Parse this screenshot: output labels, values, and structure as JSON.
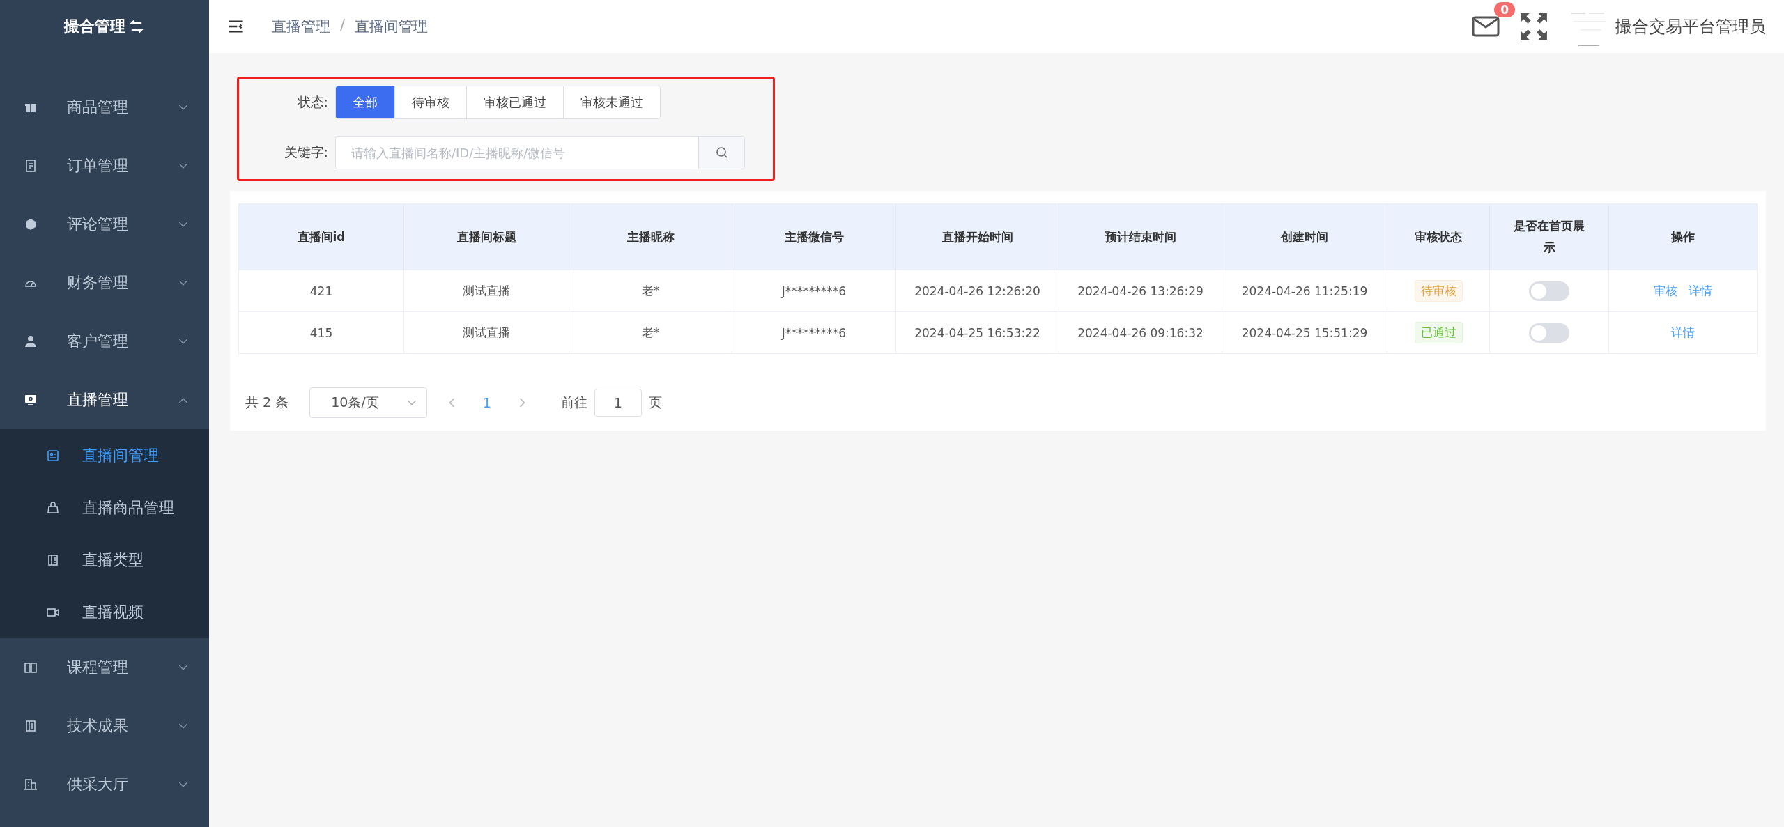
{
  "sidebar": {
    "title": "撮合管理",
    "items": [
      {
        "label": "商品管理",
        "expanded": false
      },
      {
        "label": "订单管理",
        "expanded": false
      },
      {
        "label": "评论管理",
        "expanded": false
      },
      {
        "label": "财务管理",
        "expanded": false
      },
      {
        "label": "客户管理",
        "expanded": false
      },
      {
        "label": "直播管理",
        "expanded": true,
        "children": [
          {
            "label": "直播间管理",
            "selected": true
          },
          {
            "label": "直播商品管理",
            "selected": false
          },
          {
            "label": "直播类型",
            "selected": false
          },
          {
            "label": "直播视频",
            "selected": false
          }
        ]
      },
      {
        "label": "课程管理",
        "expanded": false
      },
      {
        "label": "技术成果",
        "expanded": false
      },
      {
        "label": "供采大厅",
        "expanded": false
      }
    ]
  },
  "header": {
    "breadcrumbs": [
      "直播管理",
      "/",
      "直播间管理"
    ],
    "message_count": "0",
    "user_name": "撮合交易平台管理员"
  },
  "filter": {
    "status_label": "状态:",
    "status_tabs": [
      {
        "label": "全部",
        "selected": true
      },
      {
        "label": "待审核",
        "selected": false
      },
      {
        "label": "审核已通过",
        "selected": false
      },
      {
        "label": "审核未通过",
        "selected": false
      }
    ],
    "keyword_label": "关键字:",
    "keyword_placeholder": "请输入直播间名称/ID/主播昵称/微信号"
  },
  "table": {
    "columns": [
      "直播间id",
      "直播间标题",
      "主播昵称",
      "主播微信号",
      "直播开始时间",
      "预计结束时间",
      "创建时间",
      "审核状态",
      "是否在首页展示",
      "操作"
    ],
    "rows": [
      {
        "cells": [
          "421",
          "测试直播",
          "老*",
          "J*********6",
          "2024-04-26 12:26:20",
          "2024-04-26 13:26:29",
          "2024-04-26 11:25:19"
        ],
        "status": {
          "label": "待审核",
          "kind": "pending"
        },
        "on_home": false,
        "actions": [
          "审核",
          "详情"
        ]
      },
      {
        "cells": [
          "415",
          "测试直播",
          "老*",
          "J*********6",
          "2024-04-25 16:53:22",
          "2024-04-26 09:16:32",
          "2024-04-25 15:51:29"
        ],
        "status": {
          "label": "已通过",
          "kind": "approved"
        },
        "on_home": false,
        "actions": [
          "详情"
        ]
      }
    ]
  },
  "pagination": {
    "total": "共 2 条",
    "page_size": "10条/页",
    "pages": [
      {
        "label": "1",
        "selected": true
      }
    ],
    "goto_label": "前往",
    "goto_value": "1",
    "page_suffix": "页"
  }
}
